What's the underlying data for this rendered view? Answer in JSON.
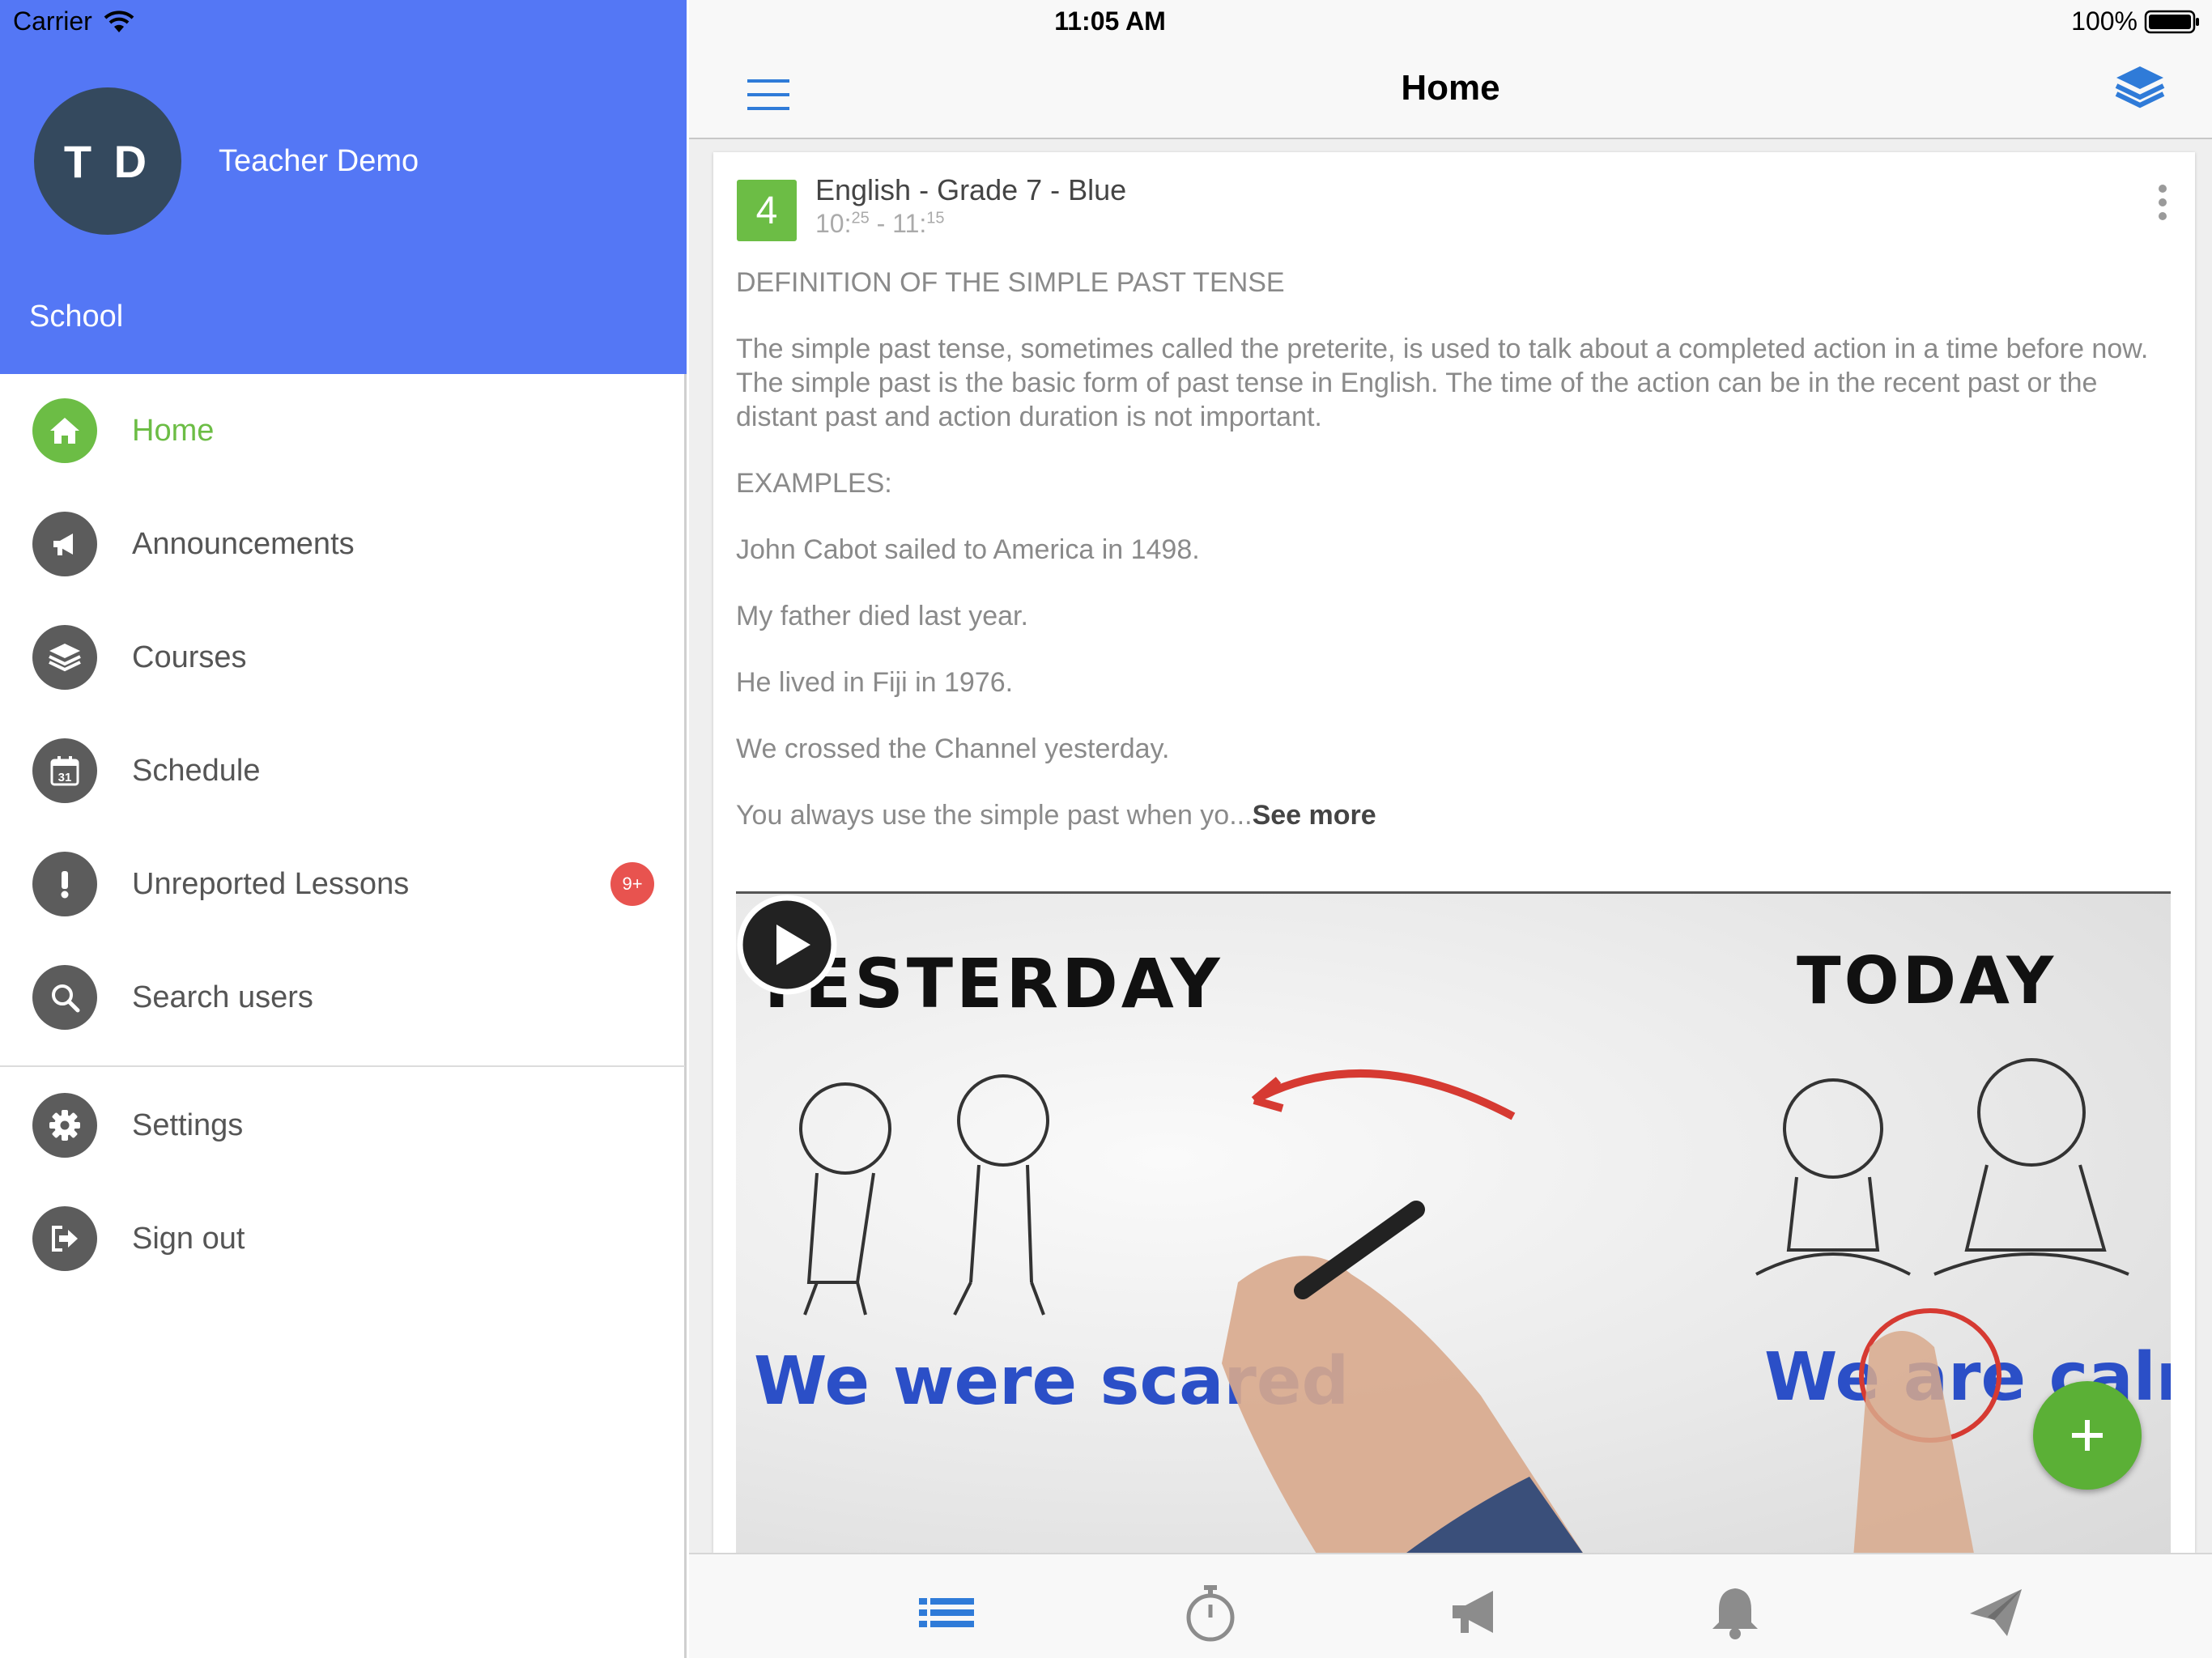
{
  "status_bar": {
    "carrier": "Carrier",
    "time": "11:05 AM",
    "battery": "100%"
  },
  "profile": {
    "initials": "T D",
    "name": "Teacher Demo",
    "school": "School"
  },
  "sidebar": {
    "items": [
      {
        "label": "Home",
        "icon": "home-icon",
        "active": true
      },
      {
        "label": "Announcements",
        "icon": "megaphone-icon"
      },
      {
        "label": "Courses",
        "icon": "layers-icon"
      },
      {
        "label": "Schedule",
        "icon": "calendar-icon",
        "icon_text": "31"
      },
      {
        "label": "Unreported Lessons",
        "icon": "exclamation-icon",
        "badge": "9+"
      },
      {
        "label": "Search users",
        "icon": "search-icon"
      },
      {
        "label": "Settings",
        "icon": "gear-icon"
      },
      {
        "label": "Sign out",
        "icon": "sign-out-icon"
      }
    ]
  },
  "header": {
    "title": "Home"
  },
  "lesson": {
    "number": "4",
    "course": "English - Grade 7 - Blue",
    "start_hour": "10:",
    "start_min": "25",
    "separator": " - ",
    "end_hour": "11:",
    "end_min": "15",
    "paragraphs": [
      "DEFINITION OF THE SIMPLE PAST TENSE",
      "The simple past tense, sometimes called the preterite, is used to talk about a completed action in a time before now. The simple past is the basic form of past tense in English. The time of the action can be in the recent past or the distant past and action duration is not important.",
      "EXAMPLES:",
      "John Cabot sailed to America in 1498.",
      "My father died last year.",
      "He lived in Fiji in 1976.",
      "We crossed the Channel yesterday."
    ],
    "truncated": "You always use the simple past when yo...",
    "see_more": "See more"
  },
  "video": {
    "left_heading": "YESTERDAY",
    "right_heading": "TODAY",
    "left_caption": "We were scared",
    "right_caption": "We are calm"
  },
  "bottom_tabs": [
    {
      "icon": "list-icon",
      "active": true
    },
    {
      "icon": "timer-icon"
    },
    {
      "icon": "megaphone-icon"
    },
    {
      "icon": "bell-icon"
    },
    {
      "icon": "paper-plane-icon"
    }
  ],
  "colors": {
    "header_blue": "#5477f5",
    "green": "#6cbd45",
    "badge_red": "#e8534f",
    "tab_blue": "#2f7bd8",
    "icon_gray": "#5c5c5c"
  }
}
